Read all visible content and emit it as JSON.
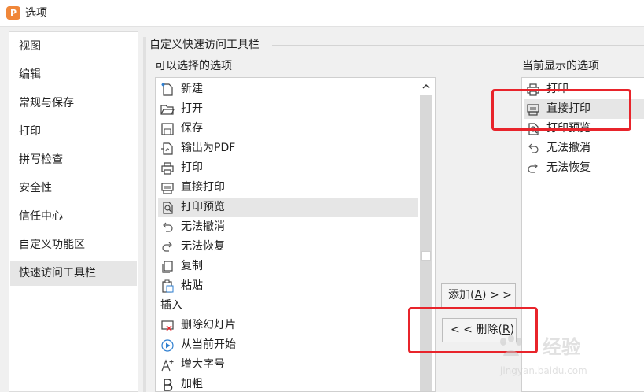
{
  "window": {
    "title": "选项",
    "logo": "P"
  },
  "sidebar": {
    "items": [
      {
        "label": "视图",
        "active": false
      },
      {
        "label": "编辑",
        "active": false
      },
      {
        "label": "常规与保存",
        "active": false
      },
      {
        "label": "打印",
        "active": false
      },
      {
        "label": "拼写检查",
        "active": false
      },
      {
        "label": "安全性",
        "active": false
      },
      {
        "label": "信任中心",
        "active": false
      },
      {
        "label": "自定义功能区",
        "active": false
      },
      {
        "label": "快速访问工具栏",
        "active": true
      }
    ]
  },
  "main": {
    "group_title": "自定义快速访问工具栏",
    "available_caption": "可以选择的选项",
    "current_caption": "当前显示的选项",
    "available_items": [
      {
        "label": "新建",
        "icon": "new-icon"
      },
      {
        "label": "打开",
        "icon": "folder-open-icon"
      },
      {
        "label": "保存",
        "icon": "save-icon"
      },
      {
        "label": "输出为PDF",
        "icon": "export-pdf-icon"
      },
      {
        "label": "打印",
        "icon": "printer-icon"
      },
      {
        "label": "直接打印",
        "icon": "direct-print-icon"
      },
      {
        "label": "打印预览",
        "icon": "print-preview-icon",
        "selected": true
      },
      {
        "label": "无法撤消",
        "icon": "undo-icon"
      },
      {
        "label": "无法恢复",
        "icon": "redo-icon"
      },
      {
        "label": "复制",
        "icon": "copy-icon"
      },
      {
        "label": "粘贴",
        "icon": "paste-icon"
      }
    ],
    "section_label": "插入",
    "available_items_after": [
      {
        "label": "删除幻灯片",
        "icon": "delete-slide-icon"
      },
      {
        "label": "从当前开始",
        "icon": "play-from-current-icon"
      },
      {
        "label": "增大字号",
        "icon": "increase-font-icon"
      },
      {
        "label": "加粗",
        "icon": "bold-icon"
      }
    ],
    "current_items": [
      {
        "label": "打印",
        "icon": "printer-icon"
      },
      {
        "label": "直接打印",
        "icon": "direct-print-icon",
        "selected": true
      },
      {
        "label": "打印预览",
        "icon": "print-preview-icon"
      },
      {
        "label": "无法撤消",
        "icon": "undo-icon"
      },
      {
        "label": "无法恢复",
        "icon": "redo-icon"
      }
    ],
    "add_button": {
      "label": "添加(",
      "key": "A",
      "suffix": ")  > >"
    },
    "remove_button": {
      "label": "< <  删除(",
      "key": "R",
      "suffix": ")"
    }
  },
  "annotations": {
    "highlight_color": "#e8242b"
  },
  "watermark": {
    "brand": "经验",
    "url": "jingyan.baidu.com"
  }
}
